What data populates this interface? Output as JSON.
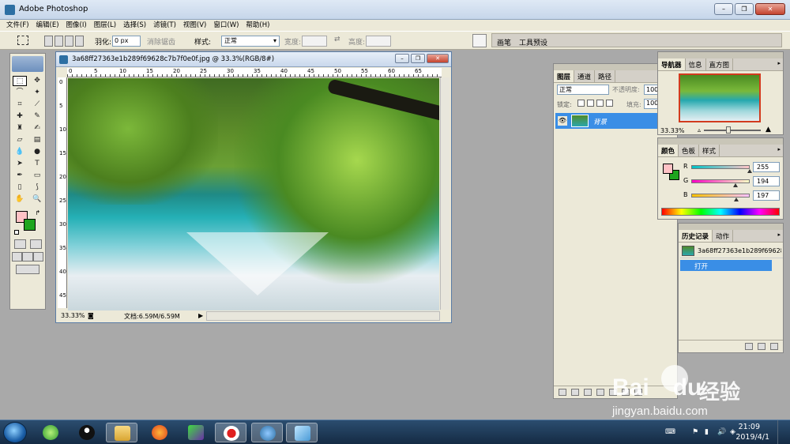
{
  "app": {
    "title": "Adobe Photoshop"
  },
  "colors": {
    "foreground": "#FFC2C5",
    "background": "#1EA51E",
    "selection": "#3A8EE6",
    "navigator_frame": "#D23B1E"
  },
  "menu": [
    "文件(F)",
    "编辑(E)",
    "图像(I)",
    "图层(L)",
    "选择(S)",
    "滤镜(T)",
    "视图(V)",
    "窗口(W)",
    "帮助(H)"
  ],
  "options": {
    "feather_label": "羽化:",
    "feather_value": "0 px",
    "antialias_label": "消除锯齿",
    "style_label": "样式:",
    "style_value": "正常",
    "width_label": "宽度:",
    "height_label": "高度:",
    "well_tabs": [
      "画笔",
      "工具预设"
    ]
  },
  "document": {
    "title": "3a68ff27363e1b289f69628c7b7f0e0f.jpg @ 33.3%(RGB/8#)",
    "zoom": "33.33%",
    "doc_info": "文档:6.59M/6.59M",
    "ruler_h": [
      "0",
      "5",
      "10",
      "15",
      "20",
      "25",
      "30",
      "35",
      "40",
      "45",
      "50",
      "55",
      "60",
      "65"
    ],
    "ruler_v": [
      "0",
      "5",
      "10",
      "15",
      "20",
      "25",
      "30",
      "35",
      "40",
      "45"
    ]
  },
  "layers_panel": {
    "tabs": [
      "图层",
      "通道",
      "路径"
    ],
    "blend_mode": "正常",
    "opacity_label": "不透明度:",
    "opacity_value": "100%",
    "lock_label": "锁定:",
    "fill_label": "填充:",
    "fill_value": "100%",
    "layer_name": "背景"
  },
  "navigator_panel": {
    "tabs": [
      "导航器",
      "信息",
      "直方图"
    ],
    "zoom": "33.33%"
  },
  "color_panel": {
    "tabs": [
      "颜色",
      "色板",
      "样式"
    ],
    "r_label": "R",
    "r_value": "255",
    "g_label": "G",
    "g_value": "194",
    "b_label": "B",
    "b_value": "197"
  },
  "history_panel": {
    "tabs": [
      "历史记录",
      "动作"
    ],
    "snapshot": "3a68ff27363e1b289f69628c7b7f0e0f.jpg",
    "step": "打开"
  },
  "watermark": {
    "brand": "Bai",
    "brand2": "du",
    "cn": "经验",
    "url": "jingyan.baidu.com"
  },
  "taskbar": {
    "time": "21:09",
    "date": "2019/4/1"
  }
}
